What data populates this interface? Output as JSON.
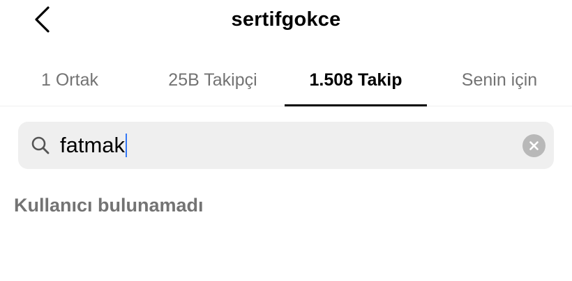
{
  "header": {
    "title": "sertifgokce",
    "back_icon": "chevron-left-icon"
  },
  "tabs": [
    {
      "label": "1 Ortak",
      "active": false
    },
    {
      "label": "25B Takipçi",
      "active": false
    },
    {
      "label": "1.508 Takip",
      "active": true
    },
    {
      "label": "Senin için",
      "active": false
    }
  ],
  "search": {
    "value": "fatmak",
    "search_icon": "search-icon",
    "clear_icon": "clear-icon"
  },
  "results": {
    "empty_message": "Kullanıcı bulunamadı"
  },
  "colors": {
    "active_text": "#000000",
    "inactive_text": "#737373",
    "search_bg": "#efefef",
    "caret": "#3478f6"
  }
}
